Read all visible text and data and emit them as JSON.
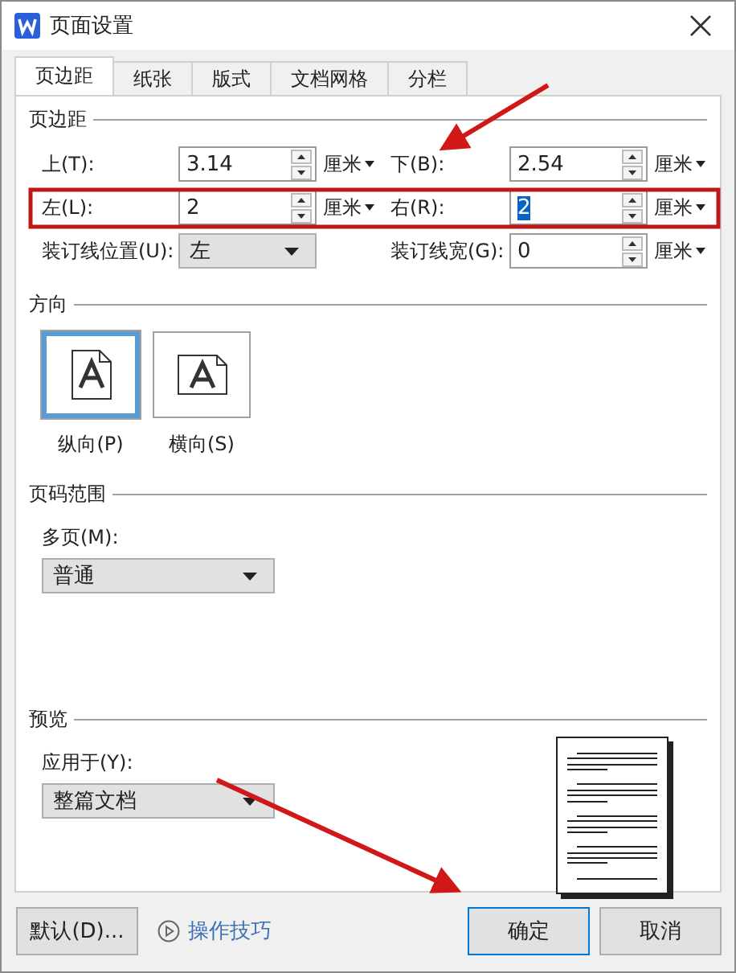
{
  "window": {
    "title": "页面设置"
  },
  "tabs": [
    {
      "label": "页边距",
      "selected": true
    },
    {
      "label": "纸张",
      "selected": false
    },
    {
      "label": "版式",
      "selected": false
    },
    {
      "label": "文档网格",
      "selected": false
    },
    {
      "label": "分栏",
      "selected": false
    }
  ],
  "margins": {
    "heading": "页边距",
    "fields": [
      {
        "kind": "spin",
        "label": "上(T):",
        "value": "3.14",
        "unit": "厘米",
        "text_selected": false
      },
      {
        "kind": "spin",
        "label": "下(B):",
        "value": "2.54",
        "unit": "厘米",
        "text_selected": false
      },
      {
        "kind": "spin",
        "label": "左(L):",
        "value": "2",
        "unit": "厘米",
        "text_selected": false
      },
      {
        "kind": "spin",
        "label": "右(R):",
        "value": "2",
        "unit": "厘米",
        "text_selected": true
      },
      {
        "kind": "select",
        "label": "装订线位置(U):",
        "value": "左"
      },
      {
        "kind": "spin",
        "label": "装订线宽(G):",
        "value": "0",
        "unit": "厘米",
        "text_selected": false
      }
    ]
  },
  "orientation": {
    "heading": "方向",
    "options": [
      {
        "kind": "portrait",
        "label": "纵向(P)",
        "selected": true
      },
      {
        "kind": "landscape",
        "label": "横向(S)",
        "selected": false
      }
    ]
  },
  "page_range": {
    "heading": "页码范围",
    "label": "多页(M):",
    "value": "普通"
  },
  "preview": {
    "heading": "预览",
    "label": "应用于(Y):",
    "value": "整篇文档"
  },
  "footer": {
    "default_button": "默认(D)...",
    "tips_link": "操作技巧",
    "ok_button": "确定",
    "cancel_button": "取消"
  }
}
